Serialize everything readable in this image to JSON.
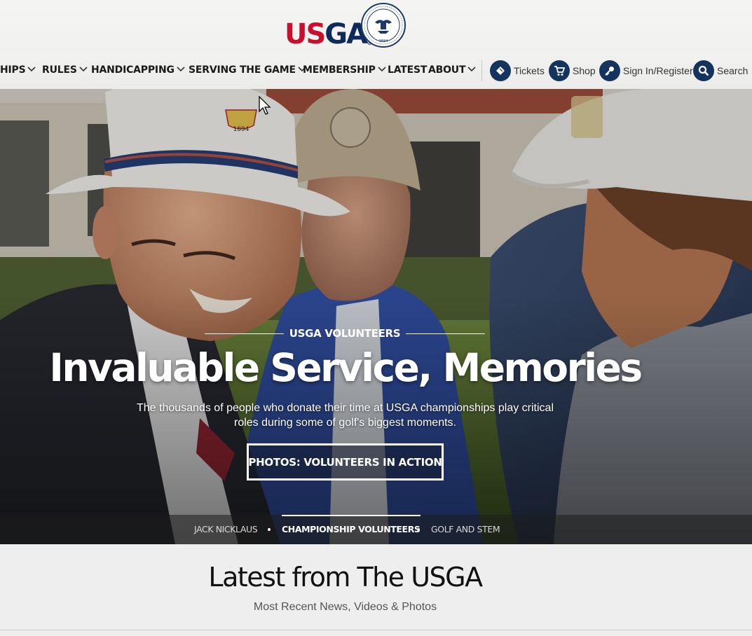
{
  "brand": {
    "logo_text_red": "US",
    "logo_text_blue": "GA",
    "registered": "®",
    "seal_year": "1894"
  },
  "nav": {
    "items": [
      {
        "label": "HIPS",
        "has_dropdown": true
      },
      {
        "label": "RULES",
        "has_dropdown": true
      },
      {
        "label": "HANDICAPPING",
        "has_dropdown": true
      },
      {
        "label": "SERVING THE GAME",
        "has_dropdown": true
      },
      {
        "label": "MEMBERSHIP",
        "has_dropdown": true
      },
      {
        "label": "LATEST",
        "has_dropdown": false
      },
      {
        "label": "ABOUT",
        "has_dropdown": true
      }
    ],
    "utility": [
      {
        "label": "Tickets",
        "icon": "ticket-icon"
      },
      {
        "label": "Shop",
        "icon": "cart-icon"
      },
      {
        "label": "Sign In/Register",
        "icon": "key-icon"
      },
      {
        "label": "Search",
        "icon": "search-icon"
      }
    ]
  },
  "hero": {
    "kicker": "USGA VOLUNTEERS",
    "headline": "Invaluable Service, Memories",
    "dek": "The thousands of people who donate their time at USGA championships play critical roles during some of golf's biggest moments.",
    "cta": "PHOTOS: VOLUNTEERS IN ACTION",
    "hat_badge_year": "1894",
    "stories": [
      {
        "label": "JACK NICKLAUS",
        "active": false
      },
      {
        "label": "CHAMPIONSHIP VOLUNTEERS",
        "active": true
      },
      {
        "label": "GOLF AND STEM",
        "active": false
      }
    ]
  },
  "latest": {
    "title": "Latest from The USGA",
    "subtitle": "Most Recent News, Videos & Photos"
  },
  "colors": {
    "usga_red": "#c8102e",
    "usga_navy": "#0d2a5b",
    "icon_circle": "#14345e",
    "page_bg": "#eeeeee"
  }
}
